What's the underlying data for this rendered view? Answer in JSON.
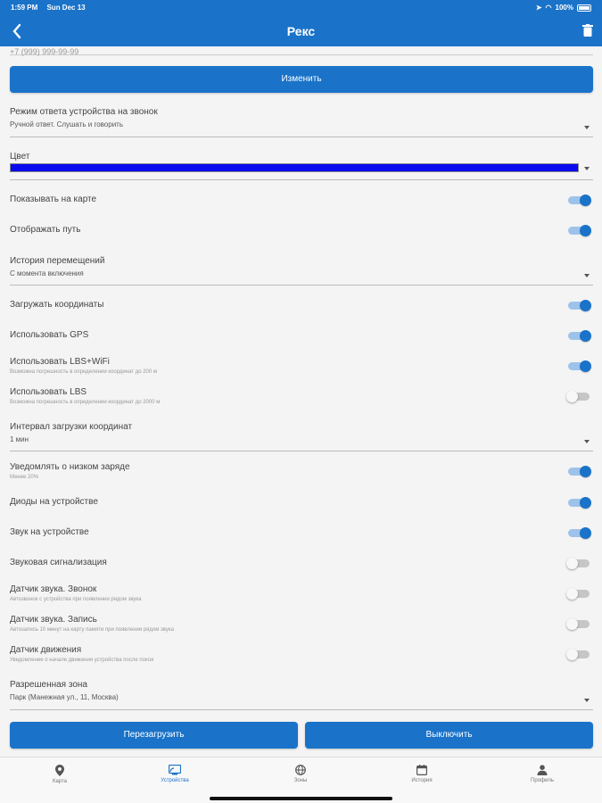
{
  "status": {
    "time": "1:59 PM",
    "date": "Sun Dec 13",
    "battery": "100%"
  },
  "header": {
    "title": "Рекс"
  },
  "partial_field": {
    "value": "+7 (999) 999-99-99"
  },
  "change_button": "Изменить",
  "answer_mode": {
    "label": "Режим ответа устройства на звонок",
    "value": "Ручной ответ. Слушать и говорить"
  },
  "color_field": {
    "label": "Цвет",
    "color": "#0a0aee"
  },
  "toggles_a": [
    {
      "label": "Показывать на карте",
      "on": true
    },
    {
      "label": "Отображать путь",
      "on": true
    }
  ],
  "history": {
    "label": "История перемещений",
    "value": "С момента включения"
  },
  "toggles_b": [
    {
      "label": "Загружать координаты",
      "sub": "",
      "on": true
    },
    {
      "label": "Использовать GPS",
      "sub": "",
      "on": true
    },
    {
      "label": "Использовать LBS+WiFi",
      "sub": "Возможна погрешность в определении координат до 200 м",
      "on": true
    },
    {
      "label": "Использовать LBS",
      "sub": "Возможна погрешность в определении координат до 2000 м",
      "on": false
    }
  ],
  "interval": {
    "label": "Интервал загрузки координат",
    "value": "1 мин"
  },
  "toggles_c": [
    {
      "label": "Уведомлять о низком заряде",
      "sub": "Менее 20%",
      "on": true
    },
    {
      "label": "Диоды на устройстве",
      "sub": "",
      "on": true
    },
    {
      "label": "Звук на устройстве",
      "sub": "",
      "on": true
    },
    {
      "label": "Звуковая сигнализация",
      "sub": "",
      "on": false
    },
    {
      "label": "Датчик звука. Звонок",
      "sub": "Автозвонок с устройства при появлении рядом звука",
      "on": false
    },
    {
      "label": "Датчик звука. Запись",
      "sub": "Автозапись 10 минут на карту памяти при появлении рядом звука",
      "on": false
    },
    {
      "label": "Датчик движения",
      "sub": "Уведомление о начале движения устройства после покоя",
      "on": false
    }
  ],
  "zone": {
    "label": "Разрешенная зона",
    "value": "Парк (Манежная ул., 11, Москва)"
  },
  "buttons": {
    "reboot": "Перезагрузить",
    "power_off": "Выключить"
  },
  "tabs": [
    {
      "label": "Карта",
      "icon": "map-pin-icon",
      "active": false
    },
    {
      "label": "Устройства",
      "icon": "device-icon",
      "active": true
    },
    {
      "label": "Зоны",
      "icon": "globe-icon",
      "active": false
    },
    {
      "label": "История",
      "icon": "calendar-icon",
      "active": false
    },
    {
      "label": "Профиль",
      "icon": "person-icon",
      "active": false
    }
  ],
  "colors": {
    "primary": "#1a73c9",
    "toggle_track_on": "#9ec3ea",
    "toggle_track_off": "#c6c6c6"
  }
}
